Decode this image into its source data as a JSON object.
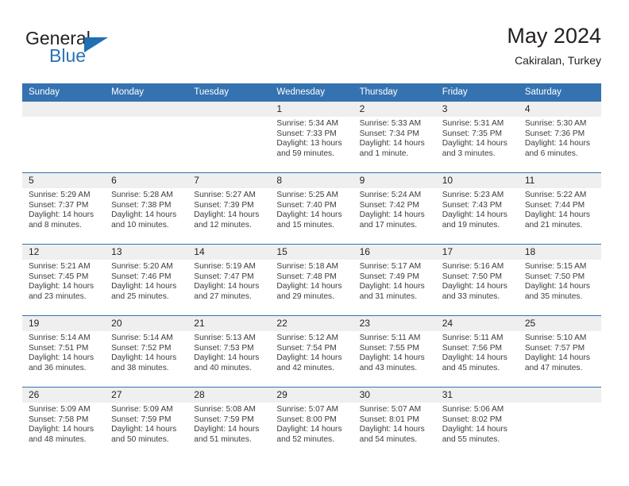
{
  "brand": {
    "name_part1": "General",
    "name_part2": "Blue",
    "flag_icon": "triangle-flag-icon"
  },
  "header": {
    "title": "May 2024",
    "subtitle": "Cakiralan, Turkey"
  },
  "theme": {
    "header_blue": "#3572b0",
    "daynum_band": "#efefef",
    "text": "#231f20",
    "brand_blue": "#2b72b5"
  },
  "weekdays": [
    "Sunday",
    "Monday",
    "Tuesday",
    "Wednesday",
    "Thursday",
    "Friday",
    "Saturday"
  ],
  "weeks": [
    [
      {
        "day": "",
        "empty": true,
        "sunrise": "",
        "sunset": "",
        "daylight_line1": "",
        "daylight_line2": ""
      },
      {
        "day": "",
        "empty": true,
        "sunrise": "",
        "sunset": "",
        "daylight_line1": "",
        "daylight_line2": ""
      },
      {
        "day": "",
        "empty": true,
        "sunrise": "",
        "sunset": "",
        "daylight_line1": "",
        "daylight_line2": ""
      },
      {
        "day": "1",
        "sunrise": "Sunrise: 5:34 AM",
        "sunset": "Sunset: 7:33 PM",
        "daylight_line1": "Daylight: 13 hours",
        "daylight_line2": "and 59 minutes."
      },
      {
        "day": "2",
        "sunrise": "Sunrise: 5:33 AM",
        "sunset": "Sunset: 7:34 PM",
        "daylight_line1": "Daylight: 14 hours",
        "daylight_line2": "and 1 minute."
      },
      {
        "day": "3",
        "sunrise": "Sunrise: 5:31 AM",
        "sunset": "Sunset: 7:35 PM",
        "daylight_line1": "Daylight: 14 hours",
        "daylight_line2": "and 3 minutes."
      },
      {
        "day": "4",
        "sunrise": "Sunrise: 5:30 AM",
        "sunset": "Sunset: 7:36 PM",
        "daylight_line1": "Daylight: 14 hours",
        "daylight_line2": "and 6 minutes."
      }
    ],
    [
      {
        "day": "5",
        "sunrise": "Sunrise: 5:29 AM",
        "sunset": "Sunset: 7:37 PM",
        "daylight_line1": "Daylight: 14 hours",
        "daylight_line2": "and 8 minutes."
      },
      {
        "day": "6",
        "sunrise": "Sunrise: 5:28 AM",
        "sunset": "Sunset: 7:38 PM",
        "daylight_line1": "Daylight: 14 hours",
        "daylight_line2": "and 10 minutes."
      },
      {
        "day": "7",
        "sunrise": "Sunrise: 5:27 AM",
        "sunset": "Sunset: 7:39 PM",
        "daylight_line1": "Daylight: 14 hours",
        "daylight_line2": "and 12 minutes."
      },
      {
        "day": "8",
        "sunrise": "Sunrise: 5:25 AM",
        "sunset": "Sunset: 7:40 PM",
        "daylight_line1": "Daylight: 14 hours",
        "daylight_line2": "and 15 minutes."
      },
      {
        "day": "9",
        "sunrise": "Sunrise: 5:24 AM",
        "sunset": "Sunset: 7:42 PM",
        "daylight_line1": "Daylight: 14 hours",
        "daylight_line2": "and 17 minutes."
      },
      {
        "day": "10",
        "sunrise": "Sunrise: 5:23 AM",
        "sunset": "Sunset: 7:43 PM",
        "daylight_line1": "Daylight: 14 hours",
        "daylight_line2": "and 19 minutes."
      },
      {
        "day": "11",
        "sunrise": "Sunrise: 5:22 AM",
        "sunset": "Sunset: 7:44 PM",
        "daylight_line1": "Daylight: 14 hours",
        "daylight_line2": "and 21 minutes."
      }
    ],
    [
      {
        "day": "12",
        "sunrise": "Sunrise: 5:21 AM",
        "sunset": "Sunset: 7:45 PM",
        "daylight_line1": "Daylight: 14 hours",
        "daylight_line2": "and 23 minutes."
      },
      {
        "day": "13",
        "sunrise": "Sunrise: 5:20 AM",
        "sunset": "Sunset: 7:46 PM",
        "daylight_line1": "Daylight: 14 hours",
        "daylight_line2": "and 25 minutes."
      },
      {
        "day": "14",
        "sunrise": "Sunrise: 5:19 AM",
        "sunset": "Sunset: 7:47 PM",
        "daylight_line1": "Daylight: 14 hours",
        "daylight_line2": "and 27 minutes."
      },
      {
        "day": "15",
        "sunrise": "Sunrise: 5:18 AM",
        "sunset": "Sunset: 7:48 PM",
        "daylight_line1": "Daylight: 14 hours",
        "daylight_line2": "and 29 minutes."
      },
      {
        "day": "16",
        "sunrise": "Sunrise: 5:17 AM",
        "sunset": "Sunset: 7:49 PM",
        "daylight_line1": "Daylight: 14 hours",
        "daylight_line2": "and 31 minutes."
      },
      {
        "day": "17",
        "sunrise": "Sunrise: 5:16 AM",
        "sunset": "Sunset: 7:50 PM",
        "daylight_line1": "Daylight: 14 hours",
        "daylight_line2": "and 33 minutes."
      },
      {
        "day": "18",
        "sunrise": "Sunrise: 5:15 AM",
        "sunset": "Sunset: 7:50 PM",
        "daylight_line1": "Daylight: 14 hours",
        "daylight_line2": "and 35 minutes."
      }
    ],
    [
      {
        "day": "19",
        "sunrise": "Sunrise: 5:14 AM",
        "sunset": "Sunset: 7:51 PM",
        "daylight_line1": "Daylight: 14 hours",
        "daylight_line2": "and 36 minutes."
      },
      {
        "day": "20",
        "sunrise": "Sunrise: 5:14 AM",
        "sunset": "Sunset: 7:52 PM",
        "daylight_line1": "Daylight: 14 hours",
        "daylight_line2": "and 38 minutes."
      },
      {
        "day": "21",
        "sunrise": "Sunrise: 5:13 AM",
        "sunset": "Sunset: 7:53 PM",
        "daylight_line1": "Daylight: 14 hours",
        "daylight_line2": "and 40 minutes."
      },
      {
        "day": "22",
        "sunrise": "Sunrise: 5:12 AM",
        "sunset": "Sunset: 7:54 PM",
        "daylight_line1": "Daylight: 14 hours",
        "daylight_line2": "and 42 minutes."
      },
      {
        "day": "23",
        "sunrise": "Sunrise: 5:11 AM",
        "sunset": "Sunset: 7:55 PM",
        "daylight_line1": "Daylight: 14 hours",
        "daylight_line2": "and 43 minutes."
      },
      {
        "day": "24",
        "sunrise": "Sunrise: 5:11 AM",
        "sunset": "Sunset: 7:56 PM",
        "daylight_line1": "Daylight: 14 hours",
        "daylight_line2": "and 45 minutes."
      },
      {
        "day": "25",
        "sunrise": "Sunrise: 5:10 AM",
        "sunset": "Sunset: 7:57 PM",
        "daylight_line1": "Daylight: 14 hours",
        "daylight_line2": "and 47 minutes."
      }
    ],
    [
      {
        "day": "26",
        "sunrise": "Sunrise: 5:09 AM",
        "sunset": "Sunset: 7:58 PM",
        "daylight_line1": "Daylight: 14 hours",
        "daylight_line2": "and 48 minutes."
      },
      {
        "day": "27",
        "sunrise": "Sunrise: 5:09 AM",
        "sunset": "Sunset: 7:59 PM",
        "daylight_line1": "Daylight: 14 hours",
        "daylight_line2": "and 50 minutes."
      },
      {
        "day": "28",
        "sunrise": "Sunrise: 5:08 AM",
        "sunset": "Sunset: 7:59 PM",
        "daylight_line1": "Daylight: 14 hours",
        "daylight_line2": "and 51 minutes."
      },
      {
        "day": "29",
        "sunrise": "Sunrise: 5:07 AM",
        "sunset": "Sunset: 8:00 PM",
        "daylight_line1": "Daylight: 14 hours",
        "daylight_line2": "and 52 minutes."
      },
      {
        "day": "30",
        "sunrise": "Sunrise: 5:07 AM",
        "sunset": "Sunset: 8:01 PM",
        "daylight_line1": "Daylight: 14 hours",
        "daylight_line2": "and 54 minutes."
      },
      {
        "day": "31",
        "sunrise": "Sunrise: 5:06 AM",
        "sunset": "Sunset: 8:02 PM",
        "daylight_line1": "Daylight: 14 hours",
        "daylight_line2": "and 55 minutes."
      },
      {
        "day": "",
        "empty": true,
        "sunrise": "",
        "sunset": "",
        "daylight_line1": "",
        "daylight_line2": ""
      }
    ]
  ]
}
